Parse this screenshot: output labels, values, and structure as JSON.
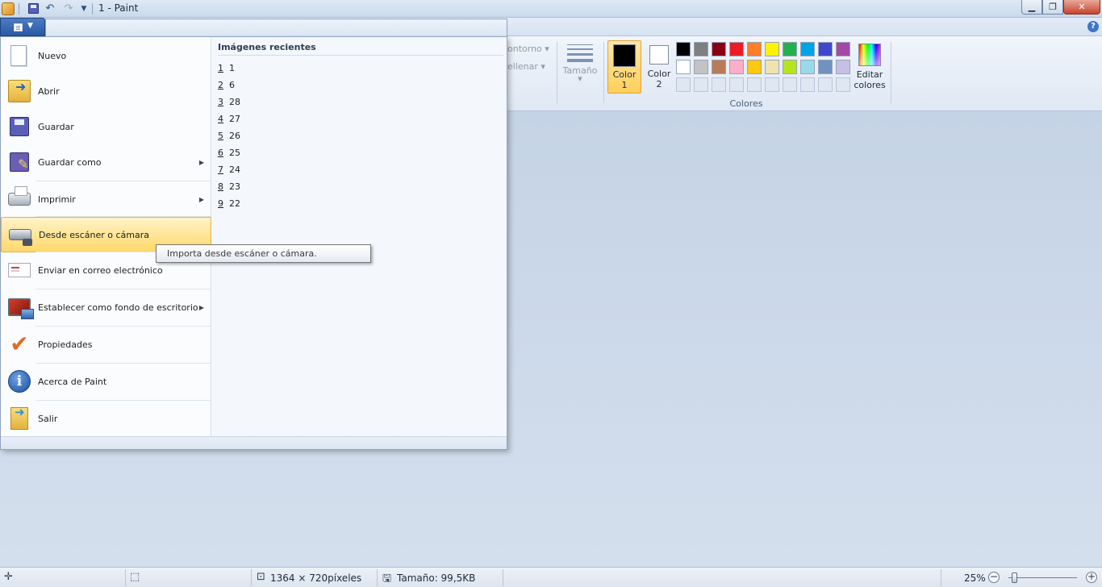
{
  "window": {
    "title": "1 - Paint",
    "controls": {
      "minimize": "▁",
      "maximize": "❐",
      "close": "✕"
    }
  },
  "quick_access": {
    "undo_icon": "↶",
    "redo_icon": "↷",
    "customize_icon": "▼"
  },
  "ribbon": {
    "help": "?",
    "outline_label": "ontorno",
    "fill_label": "ellenar",
    "dropdown_arrow": "▾",
    "size_label": "Tamaño",
    "color1_label": "Color 1",
    "color2_label": "Color 2",
    "colors_group_label": "Colores",
    "edit_colors_label": "Editar colores",
    "color1_value": "#000000",
    "color2_value": "#ffffff",
    "palette_row1": [
      "#000000",
      "#7f7f7f",
      "#880015",
      "#ed1c24",
      "#ff7f27",
      "#fff200",
      "#22b14c",
      "#00a2e8",
      "#3f48cc",
      "#a349a4"
    ],
    "palette_row2": [
      "#ffffff",
      "#c3c3c3",
      "#b97a57",
      "#ffaec9",
      "#ffc90e",
      "#efe4b0",
      "#b5e61d",
      "#99d9ea",
      "#7092be",
      "#c8bfe7"
    ]
  },
  "app_menu": {
    "items": [
      {
        "label": "Nuevo",
        "icon": "new-document-icon",
        "has_submenu": false
      },
      {
        "label": "Abrir",
        "icon": "open-folder-icon",
        "has_submenu": false
      },
      {
        "label": "Guardar",
        "icon": "save-disk-icon",
        "has_submenu": false
      },
      {
        "label": "Guardar como",
        "icon": "save-as-icon",
        "has_submenu": true
      },
      {
        "label": "Imprimir",
        "icon": "printer-icon",
        "has_submenu": true
      },
      {
        "label": "Desde escáner o cámara",
        "icon": "scanner-camera-icon",
        "has_submenu": false
      },
      {
        "label": "Enviar en correo electrónico",
        "icon": "email-icon",
        "has_submenu": false
      },
      {
        "label": "Establecer como fondo de escritorio",
        "icon": "desktop-background-icon",
        "has_submenu": true
      },
      {
        "label": "Propiedades",
        "icon": "checkmark-icon",
        "has_submenu": false
      },
      {
        "label": "Acerca de Paint",
        "icon": "info-icon",
        "has_submenu": false
      },
      {
        "label": "Salir",
        "icon": "exit-icon",
        "has_submenu": false
      }
    ],
    "highlighted_item": "Desde escáner o cámara",
    "submenu_arrow": "▶",
    "recent_title": "Imágenes recientes",
    "recent": [
      {
        "num": "1",
        "name": "1"
      },
      {
        "num": "2",
        "name": "6"
      },
      {
        "num": "3",
        "name": "28"
      },
      {
        "num": "4",
        "name": "27"
      },
      {
        "num": "5",
        "name": "26"
      },
      {
        "num": "6",
        "name": "25"
      },
      {
        "num": "7",
        "name": "24"
      },
      {
        "num": "8",
        "name": "23"
      },
      {
        "num": "9",
        "name": "22"
      }
    ]
  },
  "tooltip": {
    "text": "Importa desde escáner o cámara."
  },
  "status_bar": {
    "dimensions": "1364 × 720píxeles",
    "file_size": "Tamaño: 99,5KB",
    "zoom": "25%",
    "zoom_level_percent": 25
  }
}
